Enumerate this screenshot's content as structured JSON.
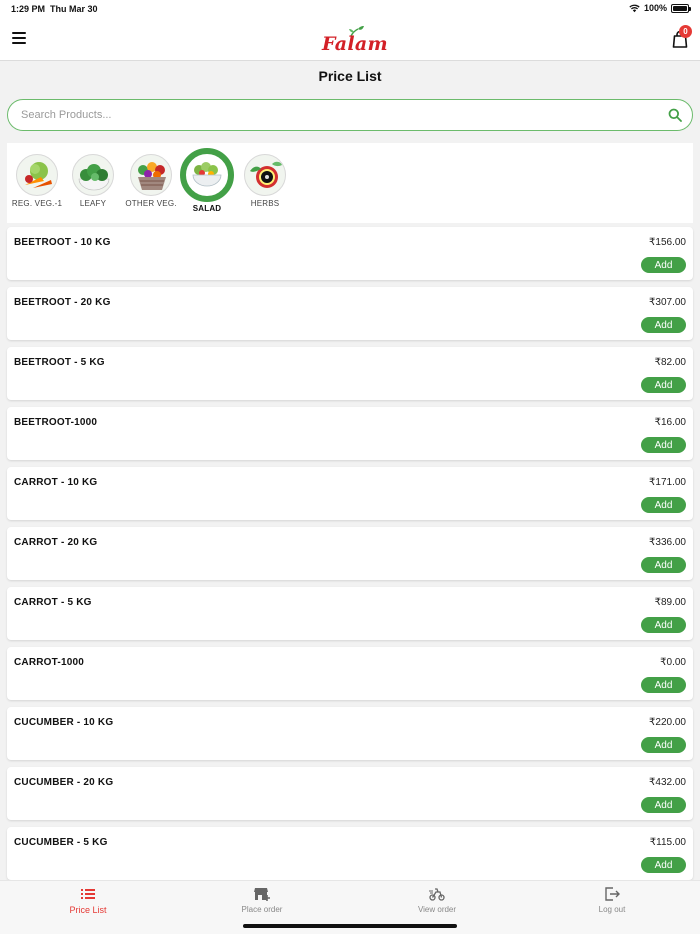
{
  "status_bar": {
    "time": "1:29 PM",
    "date": "Thu Mar 30",
    "battery": "100%"
  },
  "header": {
    "logo_text": "Falam",
    "cart_count": "0",
    "brand_colors": {
      "primary": "#d32027",
      "accent": "#43a047"
    }
  },
  "page": {
    "title": "Price List"
  },
  "search": {
    "placeholder": "Search Products...",
    "value": ""
  },
  "categories": [
    {
      "label": "REG. VEG.-1",
      "active": false,
      "icon": "mixed-vegetables-icon"
    },
    {
      "label": "LEAFY",
      "active": false,
      "icon": "leafy-greens-icon"
    },
    {
      "label": "OTHER VEG.",
      "active": false,
      "icon": "vegetable-basket-icon"
    },
    {
      "label": "SALAD",
      "active": true,
      "icon": "salad-bowl-icon"
    },
    {
      "label": "HERBS",
      "active": false,
      "icon": "herbs-icon"
    }
  ],
  "products": [
    {
      "name": "BEETROOT - 10 KG",
      "price": "₹156.00",
      "action": "Add"
    },
    {
      "name": "BEETROOT - 20 KG",
      "price": "₹307.00",
      "action": "Add"
    },
    {
      "name": "BEETROOT - 5 KG",
      "price": "₹82.00",
      "action": "Add"
    },
    {
      "name": "BEETROOT-1000",
      "price": "₹16.00",
      "action": "Add"
    },
    {
      "name": "CARROT - 10 KG",
      "price": "₹171.00",
      "action": "Add"
    },
    {
      "name": "CARROT - 20 KG",
      "price": "₹336.00",
      "action": "Add"
    },
    {
      "name": "CARROT - 5 KG",
      "price": "₹89.00",
      "action": "Add"
    },
    {
      "name": "CARROT-1000",
      "price": "₹0.00",
      "action": "Add"
    },
    {
      "name": "CUCUMBER - 10 KG",
      "price": "₹220.00",
      "action": "Add"
    },
    {
      "name": "CUCUMBER - 20 KG",
      "price": "₹432.00",
      "action": "Add"
    },
    {
      "name": "CUCUMBER - 5 KG",
      "price": "₹115.00",
      "action": "Add"
    }
  ],
  "bottom_nav": [
    {
      "label": "Price List",
      "active": true,
      "icon": "list-icon"
    },
    {
      "label": "Place order",
      "active": false,
      "icon": "store-add-icon"
    },
    {
      "label": "View order",
      "active": false,
      "icon": "delivery-bike-icon"
    },
    {
      "label": "Log out",
      "active": false,
      "icon": "logout-icon"
    }
  ]
}
